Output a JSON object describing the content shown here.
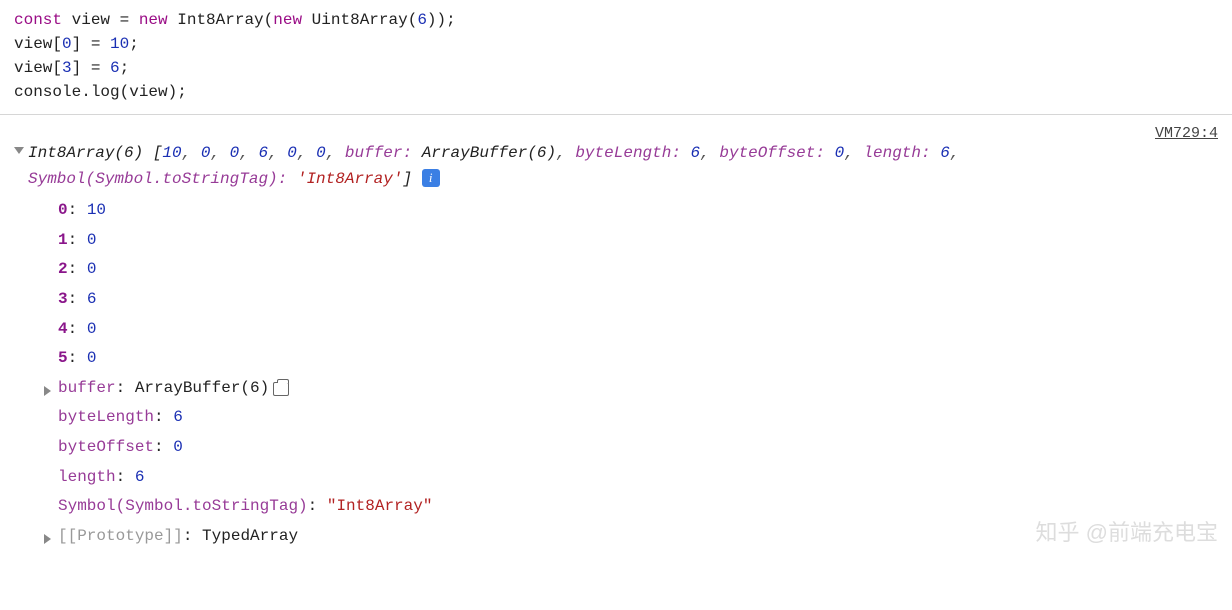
{
  "code": {
    "l1_const": "const",
    "l1_var": " view ",
    "l1_eq": "= ",
    "l1_new1": "new",
    "l1_type1": " Int8Array",
    "l1_paren1": "(",
    "l1_new2": "new",
    "l1_type2": " Uint8Array",
    "l1_paren2": "(",
    "l1_arg": "6",
    "l1_close": "));",
    "l2_pre": "view[",
    "l2_idx": "0",
    "l2_mid": "] = ",
    "l2_val": "10",
    "l2_end": ";",
    "l3_pre": "view[",
    "l3_idx": "3",
    "l3_mid": "] = ",
    "l3_val": "6",
    "l3_end": ";",
    "l4": "console.log(view);"
  },
  "source_link": "VM729:4",
  "summary": {
    "typename": "Int8Array(6)",
    "open": " [",
    "v0": "10",
    "c0": ", ",
    "v1": "0",
    "c1": ", ",
    "v2": "0",
    "c2": ", ",
    "v3": "6",
    "c3": ", ",
    "v4": "0",
    "c4": ", ",
    "v5": "0",
    "c5": ", ",
    "k_buffer": "buffer: ",
    "v_buffer": "ArrayBuffer(6)",
    "c6": ", ",
    "k_bl": "byteLength: ",
    "v_bl": "6",
    "c7": ", ",
    "k_bo": "byteOffset: ",
    "v_bo": "0",
    "c8": ", ",
    "k_len": "length: ",
    "v_len": "6",
    "c9": ", ",
    "k_sym": "Symbol(Symbol.toStringTag): ",
    "v_sym": "'Int8Array'",
    "close": "]"
  },
  "props": {
    "idx": [
      {
        "k": "0",
        "v": "10"
      },
      {
        "k": "1",
        "v": "0"
      },
      {
        "k": "2",
        "v": "0"
      },
      {
        "k": "3",
        "v": "6"
      },
      {
        "k": "4",
        "v": "0"
      },
      {
        "k": "5",
        "v": "0"
      }
    ],
    "buffer_k": "buffer",
    "buffer_v": "ArrayBuffer(6)",
    "byteLength_k": "byteLength",
    "byteLength_v": "6",
    "byteOffset_k": "byteOffset",
    "byteOffset_v": "0",
    "length_k": "length",
    "length_v": "6",
    "sym_k": "Symbol(Symbol.toStringTag)",
    "sym_v": "\"Int8Array\"",
    "proto_k": "[[Prototype]]",
    "proto_v": "TypedArray"
  },
  "info_badge": "i",
  "watermark": "知乎 @前端充电宝"
}
